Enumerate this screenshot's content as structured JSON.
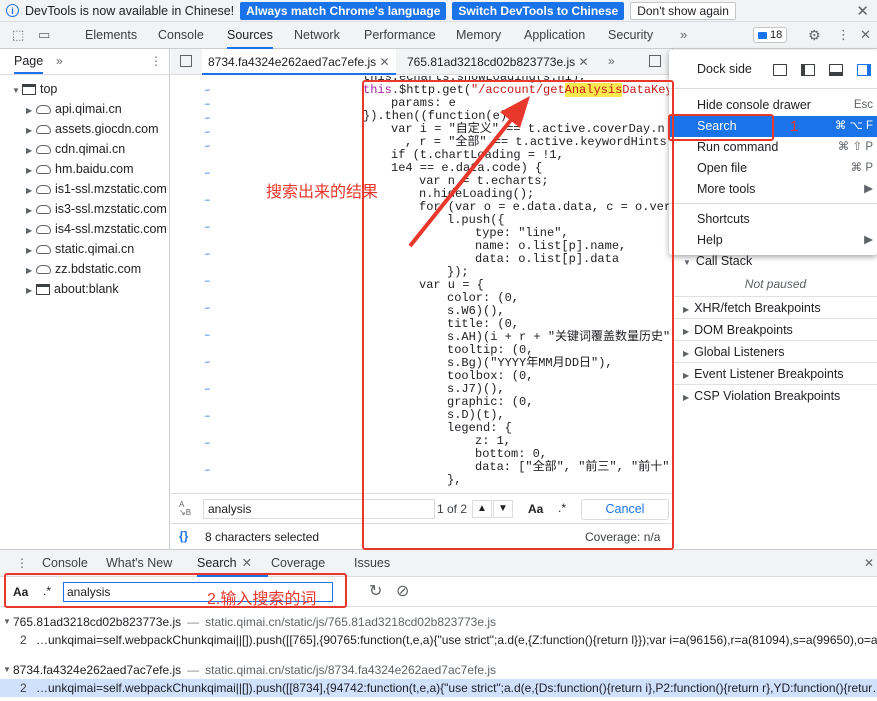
{
  "infobar": {
    "text": "DevTools is now available in Chinese!",
    "btn_match": "Always match Chrome's language",
    "btn_switch": "Switch DevTools to Chinese",
    "btn_dismiss": "Don't show again"
  },
  "main_tabs": [
    "Elements",
    "Console",
    "Sources",
    "Network",
    "Performance",
    "Memory",
    "Application",
    "Security"
  ],
  "active_main_tab": "Sources",
  "issues_count": "18",
  "navigator": {
    "tab": "Page",
    "tree": [
      "top",
      "api.qimai.cn",
      "assets.giocdn.com",
      "cdn.qimai.cn",
      "hm.baidu.com",
      "is1-ssl.mzstatic.com",
      "is3-ssl.mzstatic.com",
      "is4-ssl.mzstatic.com",
      "static.qimai.cn",
      "zz.bdstatic.com",
      "about:blank"
    ]
  },
  "editor": {
    "tabs": [
      "8734.fa4324e262aed7ac7efe.js",
      "765.81ad3218cd02b823773e.js"
    ],
    "code_lines": [
      "this.echarts.showLoading(s.ni),",
      "this.$http.get(\"/account/getAnalysisDataKey",
      "params: e",
      "}).then((function(e) {",
      "var i = \"自定义\" == t.active.coverDay.n",
      ", r = \"全部\" == t.active.keywordHints",
      "if (t.chartLoading = !1,",
      "1e4 == e.data.code) {",
      "var n = t.echarts;",
      "n.hideLoading();",
      "for (var o = e.data.data, c = o.ver",
      "l.push({",
      "type: \"line\",",
      "name: o.list[p].name,",
      "data: o.list[p].data",
      "});",
      "var u = {",
      "color: (0,",
      "s.W6)(),",
      "title: (0,",
      "s.AH)(i + r + \"关键词覆盖数量历史\"",
      "tooltip: (0,",
      "s.Bg)(\"YYYY年MM月DD日\"),",
      "toolbox: (0,",
      "s.J7)(),",
      "graphic: (0,",
      "s.D)(t),",
      "legend: {",
      "z: 1,",
      "bottom: 0,",
      "data: [\"全部\", \"前三\", \"前十\"",
      "},"
    ],
    "find": {
      "value": "analysis",
      "count": "1 of 2",
      "aa": "Aa",
      "regex": ".*",
      "cancel": "Cancel"
    },
    "status": {
      "selected": "8 characters selected",
      "coverage": "Coverage: n/a"
    }
  },
  "right_panel": {
    "sections": [
      "Call Stack",
      "Not paused",
      "XHR/fetch Breakpoints",
      "DOM Breakpoints",
      "Global Listeners",
      "Event Listener Breakpoints",
      "CSP Violation Breakpoints"
    ]
  },
  "menu": {
    "dock_side": "Dock side",
    "items": [
      {
        "label": "Hide console drawer",
        "shortcut": "Esc"
      },
      {
        "label": "Search",
        "shortcut": "⌘ ⌥ F"
      },
      {
        "label": "Run command",
        "shortcut": "⌘ ⇧ P"
      },
      {
        "label": "Open file",
        "shortcut": "⌘ P"
      },
      {
        "label": "More tools",
        "shortcut": "▶"
      },
      {
        "label": "Shortcuts",
        "shortcut": ""
      },
      {
        "label": "Help",
        "shortcut": "▶"
      }
    ]
  },
  "drawer": {
    "tabs": [
      "Console",
      "What's New",
      "Search",
      "Coverage",
      "Issues"
    ],
    "active_tab": "Search",
    "search_aa": "Aa",
    "search_regex": ".*",
    "search_value": "analysis",
    "results": [
      {
        "file": "765.81ad3218cd02b823773e.js",
        "path": "static.qimai.cn/static/js/765.81ad3218cd02b823773e.js",
        "line_no": "2",
        "line": "…unkqimai=self.webpackChunkqimai||[]).push([[765],{90765:function(t,e,a){\"use strict\";a.d(e,{Z:function(){return l}});var i=a(96156),r=a(81094),s=a(99650),o=a(…"
      },
      {
        "file": "8734.fa4324e262aed7ac7efe.js",
        "path": "static.qimai.cn/static/js/8734.fa4324e262aed7ac7efe.js",
        "line_no": "2",
        "line": "…unkqimai=self.webpackChunkqimai||[]).push([[8734],{94742:function(t,e,a){\"use strict\";a.d(e,{Ds:function(){return i},P2:function(){return r},YD:function(){retur…"
      }
    ]
  },
  "annotations": {
    "result_label": "搜索出来的结果",
    "input_label": "2.输入搜索的词",
    "step1": "1"
  },
  "colors": {
    "accent": "#1a73e8",
    "annotation_red": "#e8382b",
    "highlight": "#fce94f",
    "selection": "#cfe1fc"
  }
}
